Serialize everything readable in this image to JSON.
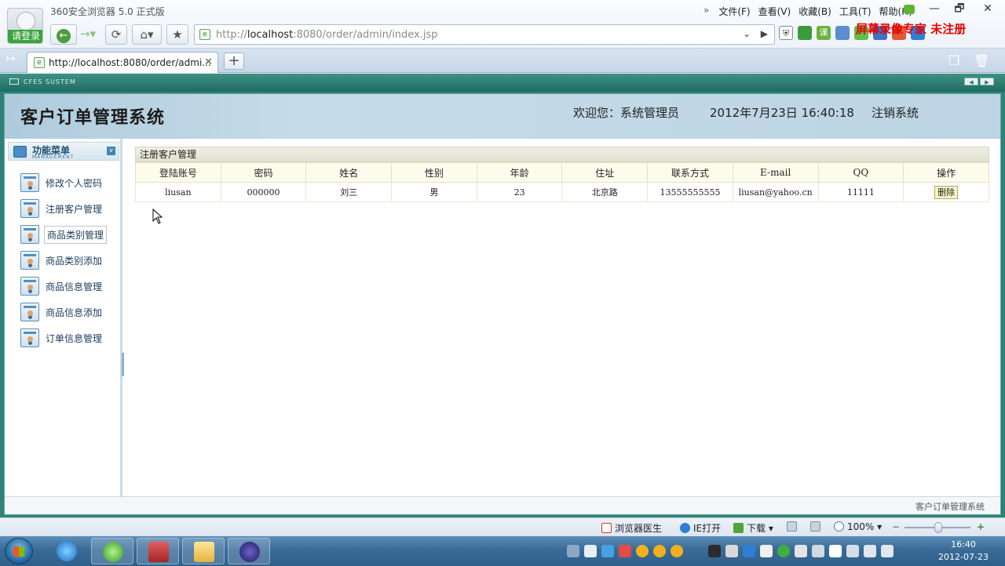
{
  "browser": {
    "title": "360安全浏览器 5.0 正式版",
    "login_label": "请登录",
    "menu": [
      "文件(F)",
      "查看(V)",
      "收藏(B)",
      "工具(T)",
      "帮助(H)"
    ],
    "menu_chevron": "»",
    "window_controls": [
      "—",
      "🗗",
      "✕"
    ],
    "url_prefix": "http://",
    "url_host": "localhost",
    "url_rest": ":8080/order/admin/index.jsp",
    "watermark": "屏幕录像专家 未注册",
    "tab_title": "http://localhost:8080/order/admi...",
    "tab_close": "✕",
    "new_tab": "+"
  },
  "page_bar": {
    "label": "CFES SUSTEM"
  },
  "header": {
    "system_title": "客户订单管理系统",
    "welcome": "欢迎您：系统管理员",
    "datetime": "2012年7月23日  16:40:18",
    "logout": "注销系统"
  },
  "sidebar": {
    "title": "功能菜单",
    "subtitle": "MANAGEMENT",
    "toggle": "v",
    "items": [
      {
        "label": "修改个人密码"
      },
      {
        "label": "注册客户管理"
      },
      {
        "label": "商品类别管理"
      },
      {
        "label": "商品类别添加"
      },
      {
        "label": "商品信息管理"
      },
      {
        "label": "商品信息添加"
      },
      {
        "label": "订单信息管理"
      }
    ],
    "active_index": 2
  },
  "panel": {
    "title": "注册客户管理",
    "columns": [
      "登陆账号",
      "密码",
      "姓名",
      "性别",
      "年龄",
      "住址",
      "联系方式",
      "E-mail",
      "QQ",
      "操作"
    ],
    "rows": [
      {
        "account": "liusan",
        "password": "000000",
        "name": "刘三",
        "gender": "男",
        "age": "23",
        "address": "北京路",
        "phone": "13555555555",
        "email": "liusan@yahoo.cn",
        "qq": "11111",
        "action": "删除"
      }
    ]
  },
  "footer": {
    "text": "客户订单管理系统"
  },
  "status_bar": {
    "doctor": "浏览器医生",
    "ie_open": "IE打开",
    "download": "下载",
    "zoom": "100%",
    "zoom_minus": "−",
    "zoom_plus": "+"
  },
  "taskbar": {
    "time": "16:40",
    "date": "2012-07-23"
  }
}
